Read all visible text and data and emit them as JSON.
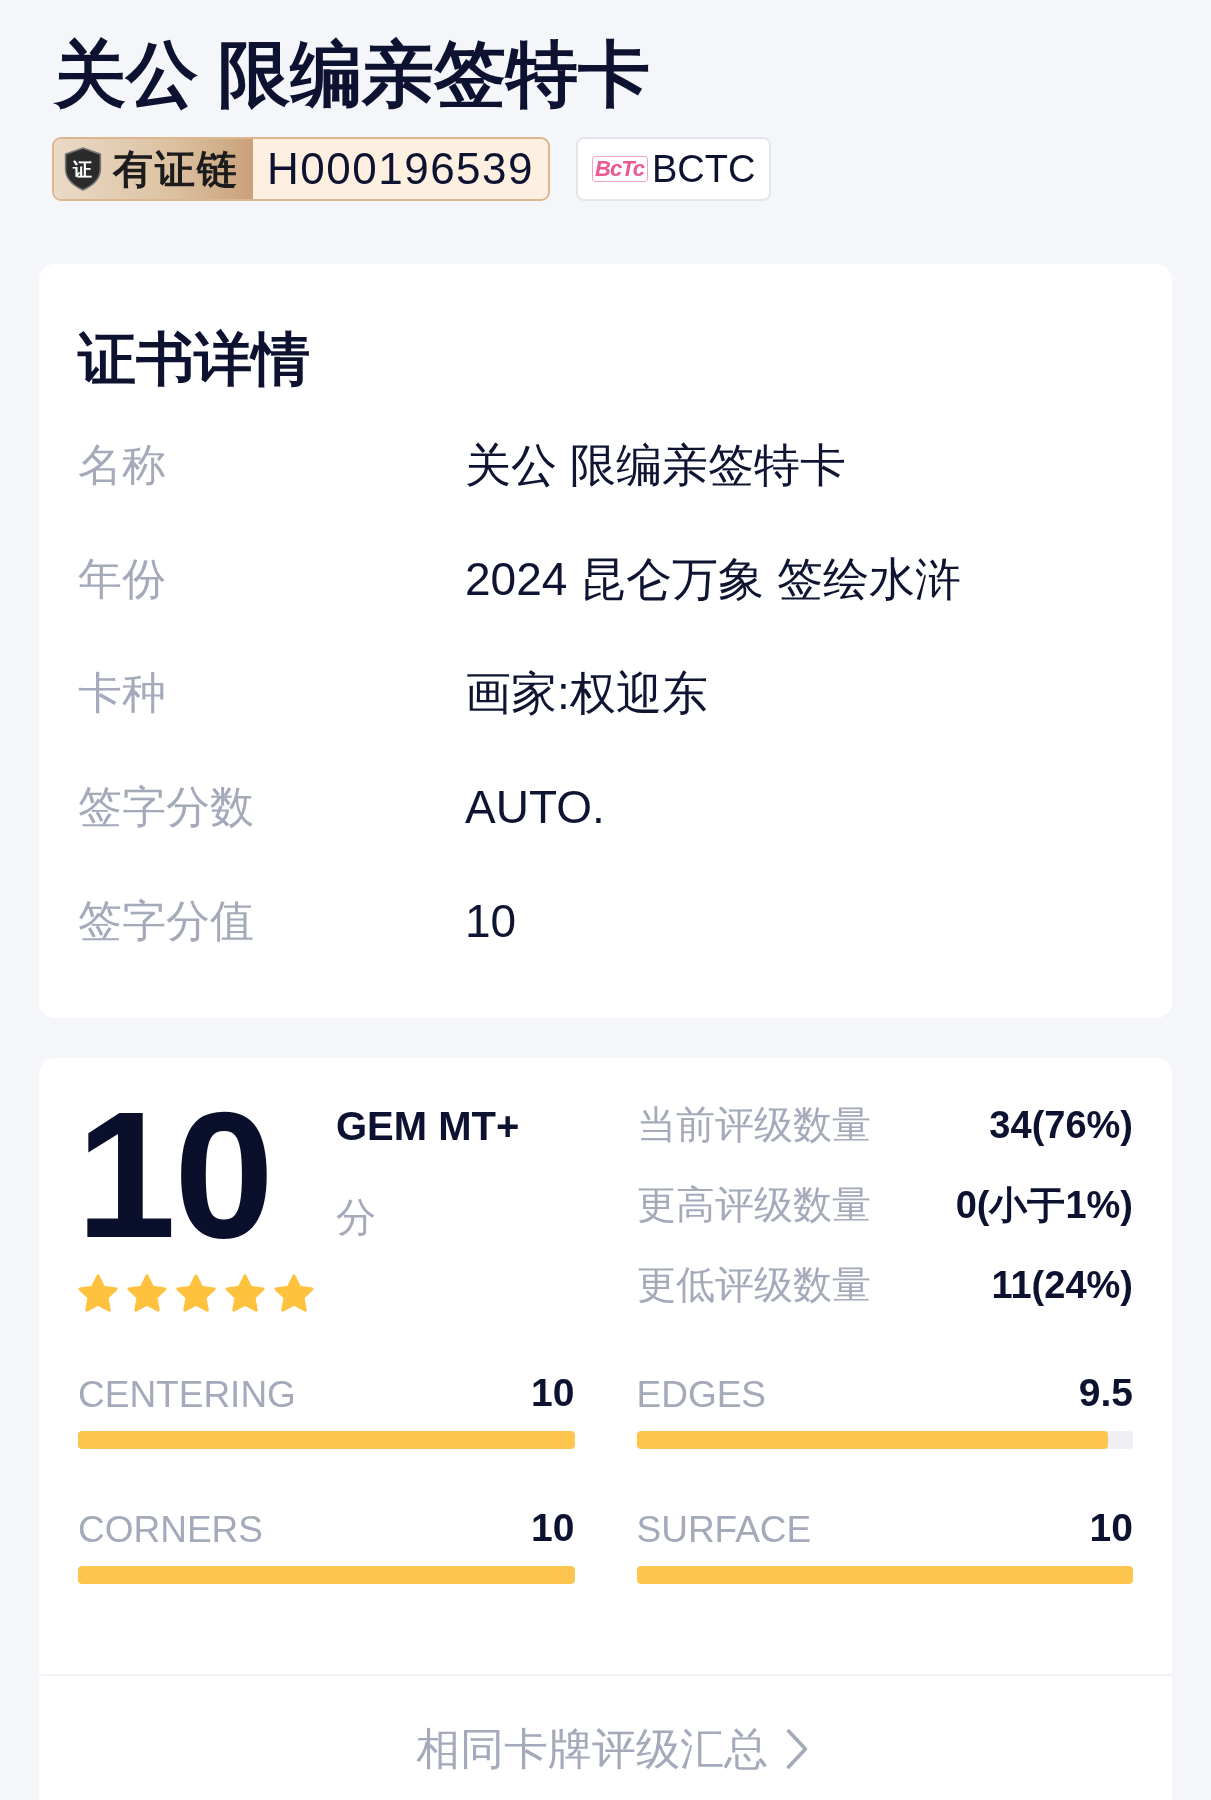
{
  "title": "关公 限编亲签特卡",
  "chain_badge": {
    "icon_text": "证",
    "label": "有证链",
    "code": "H000196539"
  },
  "grader_badge": {
    "logo_text": "BcTc",
    "label": "BCTC"
  },
  "certificate": {
    "heading": "证书详情",
    "rows": [
      {
        "label": "名称",
        "value": "关公 限编亲签特卡"
      },
      {
        "label": "年份",
        "value": "2024 昆仑万象 签绘水浒"
      },
      {
        "label": "卡种",
        "value": "画家:权迎东"
      },
      {
        "label": "签字分数",
        "value": "AUTO."
      },
      {
        "label": "签字分值",
        "value": "10"
      }
    ]
  },
  "grade": {
    "score": "10",
    "grade_name": "GEM MT+",
    "unit": "分",
    "stars": 5,
    "stats": [
      {
        "label": "当前评级数量",
        "value": "34(76%)"
      },
      {
        "label": "更高评级数量",
        "value": "0(小于1%)"
      },
      {
        "label": "更低评级数量",
        "value": "11(24%)"
      }
    ],
    "subgrades": [
      {
        "name": "CENTERING",
        "score": "10",
        "level": 1
      },
      {
        "name": "EDGES",
        "score": "9.5",
        "level": 0.95
      },
      {
        "name": "CORNERS",
        "score": "10",
        "level": 1
      },
      {
        "name": "SURFACE",
        "score": "10",
        "level": 1
      }
    ],
    "footer_link": "相同卡牌评级汇总"
  }
}
